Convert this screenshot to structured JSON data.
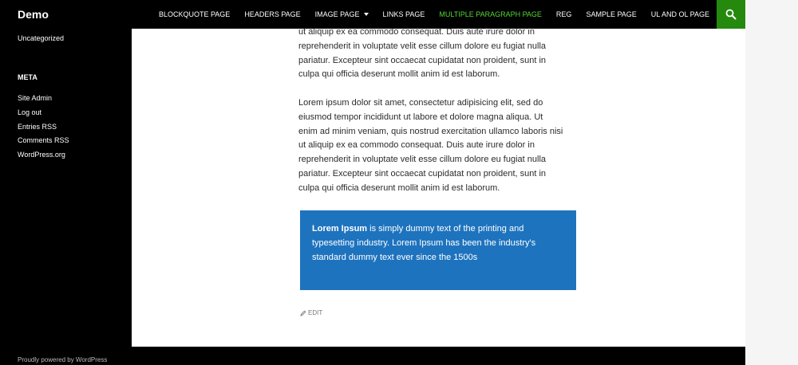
{
  "header": {
    "site_title": "Demo",
    "nav": [
      {
        "label": "BLOCKQUOTE PAGE"
      },
      {
        "label": "HEADERS PAGE"
      },
      {
        "label": "IMAGE PAGE"
      },
      {
        "label": "LINKS PAGE"
      },
      {
        "label": "MULTIPLE PARAGRAPH PAGE"
      },
      {
        "label": "REG"
      },
      {
        "label": "SAMPLE PAGE"
      },
      {
        "label": "UL AND OL PAGE"
      }
    ],
    "current_color": "#55d737",
    "search_bg": "#24890d",
    "search_icon": "search-icon"
  },
  "sidebar": {
    "category_link": "Uncategorized",
    "meta_title": "META",
    "meta_links": [
      "Site Admin",
      "Log out",
      "Entries RSS",
      "Comments RSS",
      "WordPress.org"
    ]
  },
  "content": {
    "para1_lines": [
      "ut aliquip ex ea commodo consequat. Duis aute irure dolor in",
      "reprehenderit in voluptate velit esse cillum dolore eu fugiat nulla",
      "pariatur. Excepteur sint occaecat cupidatat non proident, sunt in",
      "culpa qui officia deserunt mollit anim id est laborum."
    ],
    "para2_lines": [
      "Lorem ipsum dolor sit amet, consectetur adipisicing elit, sed do",
      "eiusmod tempor incididunt ut labore et dolore magna aliqua. Ut",
      "enim ad minim veniam, quis nostrud exercitation ullamco laboris nisi",
      "ut aliquip ex ea commodo consequat. Duis aute irure dolor in",
      "reprehenderit in voluptate velit esse cillum dolore eu fugiat nulla",
      "pariatur. Excepteur sint occaecat cupidatat non proident, sunt in",
      "culpa qui officia deserunt mollit anim id est laborum."
    ],
    "callout_bold": "Lorem Ipsum",
    "callout_line1_rest": " is simply dummy text of the printing and",
    "callout_line2": "typesetting industry. Lorem Ipsum has been the industry's",
    "callout_line3": "standard dummy text ever since the 1500s",
    "callout_bg": "#1e73be",
    "edit_label": "EDIT",
    "edit_icon": "pencil-icon"
  },
  "footer": {
    "credit": "Proudly powered by WordPress"
  }
}
